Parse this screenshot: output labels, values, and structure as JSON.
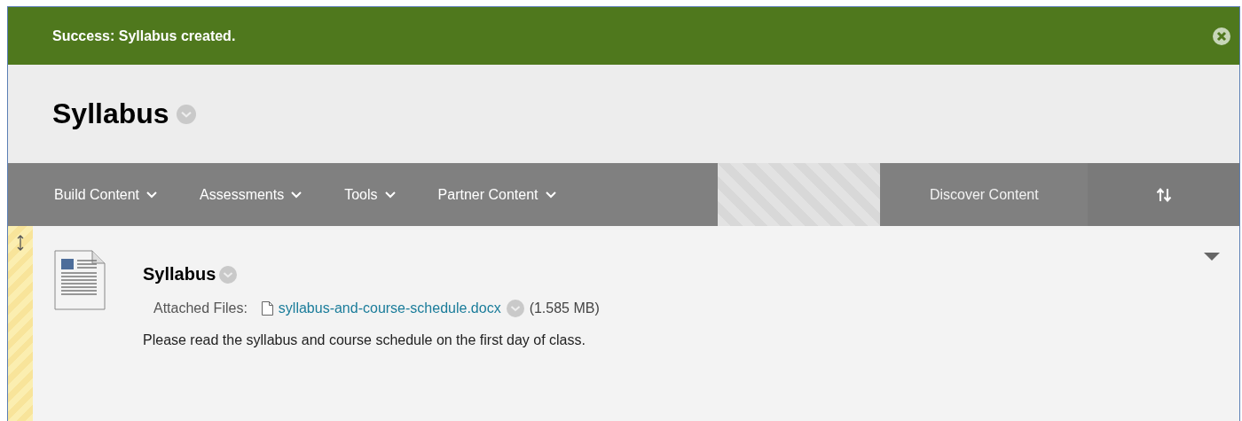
{
  "alert": {
    "message": "Success: Syllabus created."
  },
  "page_title": "Syllabus",
  "toolbar": {
    "menus": [
      {
        "label": "Build Content"
      },
      {
        "label": "Assessments"
      },
      {
        "label": "Tools"
      },
      {
        "label": "Partner Content"
      }
    ],
    "discover": "Discover Content"
  },
  "item": {
    "title": "Syllabus",
    "files_label": "Attached Files:",
    "file_name": "syllabus-and-course-schedule.docx",
    "file_size": "(1.585 MB)",
    "description": "Please read the syllabus and course schedule on the first day of class."
  }
}
